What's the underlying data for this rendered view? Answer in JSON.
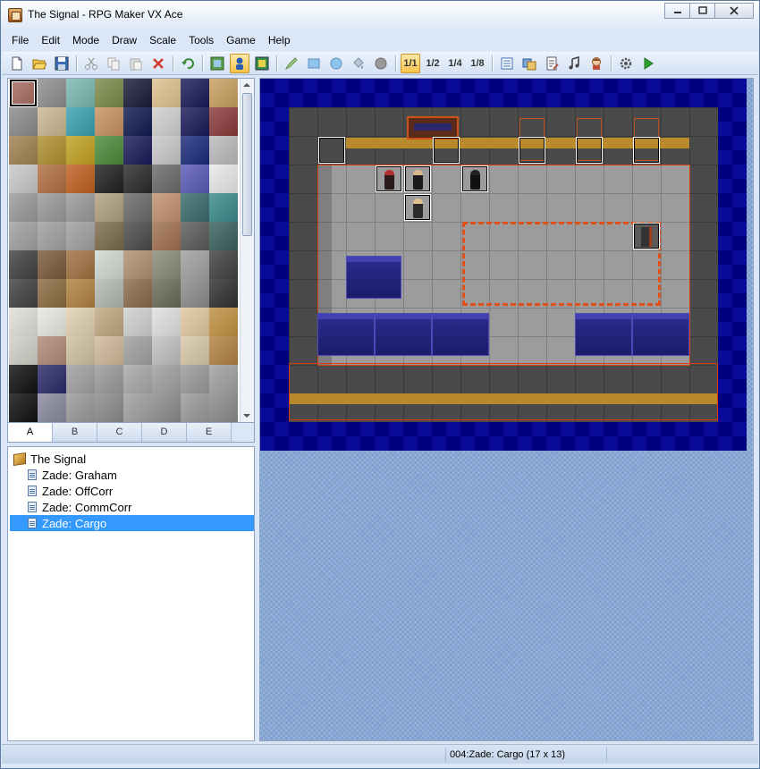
{
  "window": {
    "title": "The Signal - RPG Maker VX Ace",
    "minimize_label": "▭",
    "maximize_label": "◻",
    "close_label": "✕"
  },
  "menu": [
    "File",
    "Edit",
    "Mode",
    "Draw",
    "Scale",
    "Tools",
    "Game",
    "Help"
  ],
  "toolbar": {
    "icons": [
      "new-project-icon",
      "open-project-icon",
      "save-icon",
      "cut-icon",
      "copy-icon",
      "paste-icon",
      "delete-icon",
      "undo-icon",
      "map-mode-icon",
      "event-mode-icon",
      "region-mode-icon",
      "pencil-icon",
      "rectangle-icon",
      "ellipse-icon",
      "flood-fill-icon",
      "shadow-pen-icon",
      "database-icon",
      "resource-manager-icon",
      "script-editor-icon",
      "sound-test-icon",
      "character-generator-icon",
      "settings-icon",
      "playtest-icon"
    ],
    "scale": [
      "1/1",
      "1/2",
      "1/4",
      "1/8"
    ],
    "active": [
      "event-mode-icon",
      "scale-1-1"
    ]
  },
  "tileset": {
    "tabs": [
      "A",
      "B",
      "C",
      "D",
      "E"
    ],
    "active_tab": "A"
  },
  "map_tree": {
    "project": "The Signal",
    "maps": [
      "Zade: Graham",
      "Zade: OffCorr",
      "Zade: CommCorr",
      "Zade: Cargo"
    ],
    "selected": "Zade: Cargo"
  },
  "status": {
    "map_info": "004:Zade: Cargo (17 x 13)"
  },
  "colors": {
    "selection": "#3399ff",
    "map_void": "#00007e",
    "floor": "#9c9c9c",
    "wall": "#4a4a4a",
    "stripe": "#b88a2c",
    "crate": "#2c2c8e",
    "red_outline": "#d04010"
  }
}
